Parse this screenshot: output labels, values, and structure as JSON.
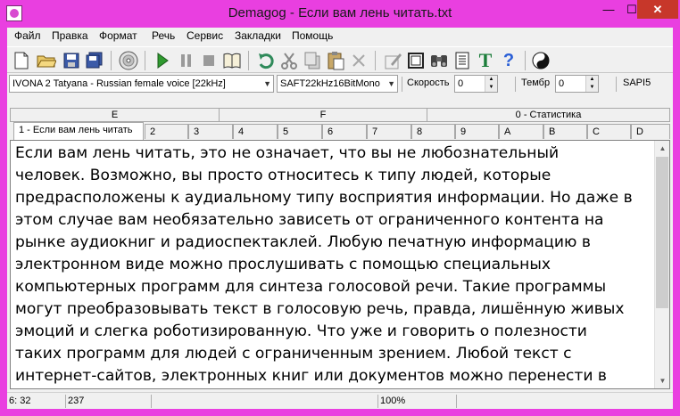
{
  "window": {
    "title": "Demagog - Если вам лень читать.txt",
    "min_label": "—",
    "max_label": "☐",
    "close_label": "✕"
  },
  "menu": [
    "Файл",
    "Правка",
    "Формат",
    "Речь",
    "Сервис",
    "Закладки",
    "Помощь"
  ],
  "toolbar": {
    "icons": [
      "new-file-icon",
      "open-folder-icon",
      "save-icon",
      "save-all-icon",
      "cd-icon",
      "play-icon",
      "pause-icon",
      "stop-icon",
      "book-icon",
      "undo-icon",
      "cut-icon",
      "copy-icon",
      "paste-icon",
      "delete-icon",
      "edit-icon",
      "frame-icon",
      "binoculars-icon",
      "list-icon",
      "font-t-icon",
      "help-icon",
      "yin-yang-icon"
    ],
    "font_letter": "T",
    "help_letter": "?"
  },
  "voicebar": {
    "voice": "IVONA 2 Tatyana - Russian female voice [22kHz]",
    "format": "SAFT22kHz16BitMono",
    "speed_label": "Скорость",
    "speed_value": "0",
    "timbre_label": "Тембр",
    "timbre_value": "0",
    "engine": "SAPI5"
  },
  "tab_groups": [
    "E",
    "F",
    "0 - Статистика"
  ],
  "tabs": [
    "1 - Если вам лень читать",
    "2",
    "3",
    "4",
    "5",
    "6",
    "7",
    "8",
    "9",
    "A",
    "B",
    "C",
    "D"
  ],
  "document": {
    "text": "Если вам лень читать, это не означает, что вы не любознательный\nчеловек. Возможно, вы просто относитесь к типу людей, которые\nпредрасположены к аудиальному типу восприятия информации. Но даже в\nэтом случае вам необязательно зависеть от ограниченного контента на\nрынке аудиокниг и радиоспектаклей. Любую печатную информацию в\nэлектронном виде можно прослушивать с помощью специальных\nкомпьютерных программ для синтеза голосовой речи. Такие программы\nмогут преобразовывать текст в голосовую речь, правда, лишённую живых\nэмоций и слегка роботизированную. Что уже и говорить о полезности\nтаких программ для людей с ограниченным зрением. Любой текст с\nинтернет-сайтов, электронных книг или документов можно перенести в"
  },
  "status": {
    "position": "6: 32",
    "count": "237",
    "zoom": "100%"
  },
  "colors": {
    "frame": "#e93fe0",
    "close": "#c7372a",
    "play": "#2f9a2f",
    "font_t": "#1b7d3a",
    "help": "#2a5fd6"
  }
}
